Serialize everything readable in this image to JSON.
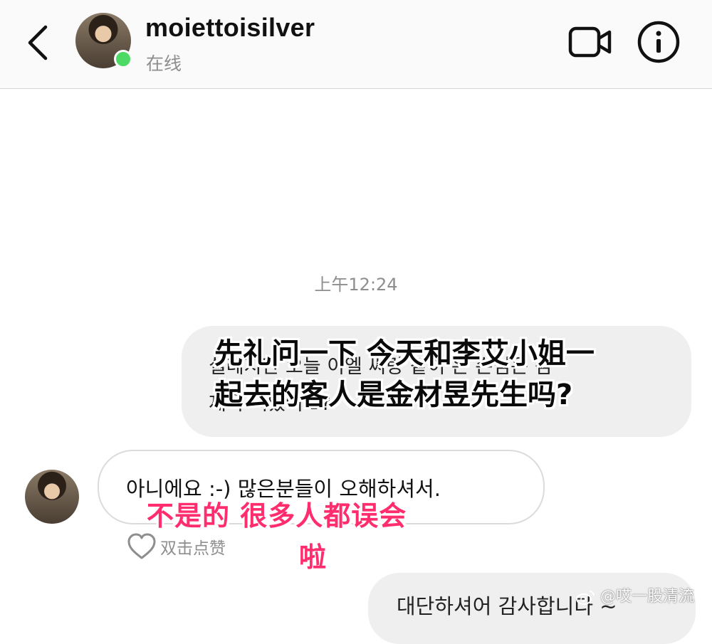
{
  "header": {
    "username": "moiettoisilver",
    "status": "在线"
  },
  "conversation": {
    "timestamp": "上午12:24",
    "outgoing_1": {
      "original_line1": "실례지만 오늘 이엘 씨랑 같이 온 손님은 김",
      "original_line2": "재욱 씨였어요?",
      "subtitle_line1": "先礼问一下 今天和李艾小姐一",
      "subtitle_line2": "起去的客人是金材昱先生吗?"
    },
    "incoming_1": {
      "original": "아니에요 :-) 많은분들이 오해하셔서.",
      "subtitle_line1": "不是的 很多人都误会",
      "subtitle_line2": "啦",
      "like_hint": "双击点赞"
    },
    "outgoing_2": {
      "original": "대단하셔어 감사합니다 ~"
    }
  },
  "watermark": "@哎一股清流",
  "colors": {
    "online": "#4cd964",
    "subtitle_pink": "#ff2d6d",
    "bubble_gray": "#efefef"
  }
}
